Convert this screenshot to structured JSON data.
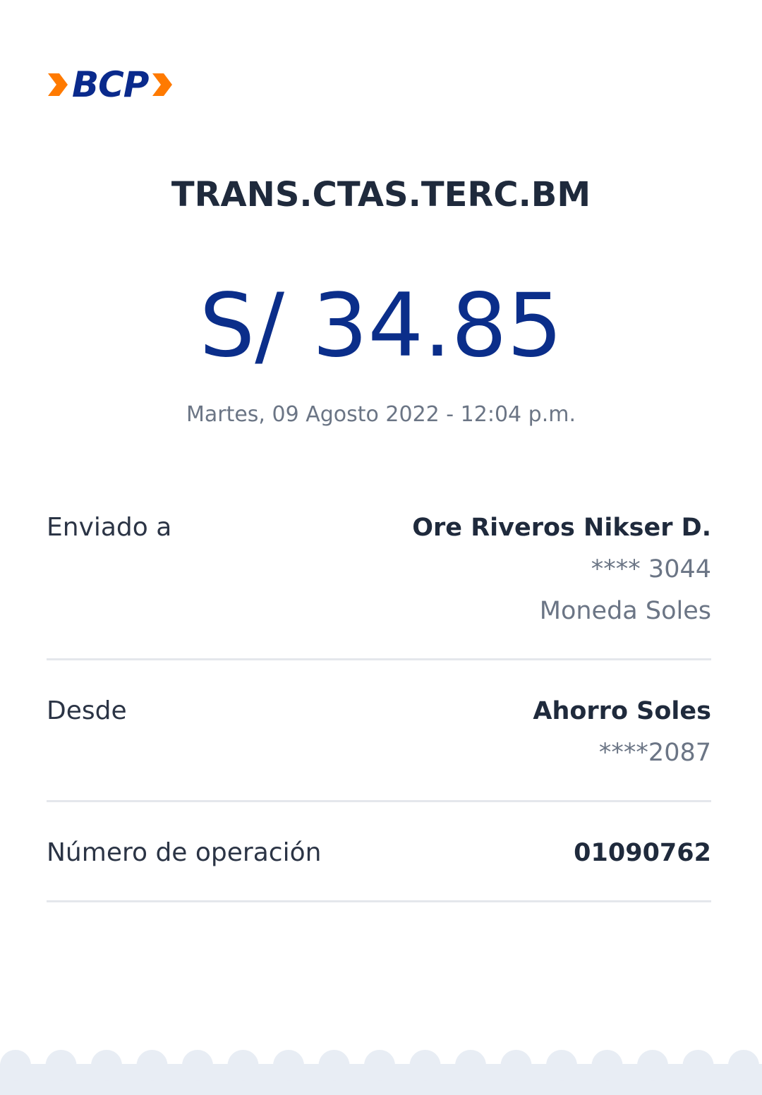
{
  "brand": {
    "name": "BCP",
    "primary_color": "#0a2a8c",
    "accent_color": "#ff7a00"
  },
  "receipt": {
    "title": "TRANS.CTAS.TERC.BM",
    "amount": "S/ 34.85",
    "datetime": "Martes, 09 Agosto 2022 - 12:04 p.m."
  },
  "details": {
    "sent_to": {
      "label": "Enviado a",
      "name": "Ore Riveros Nikser D.",
      "account": "**** 3044",
      "currency": "Moneda Soles"
    },
    "from": {
      "label": "Desde",
      "account_type": "Ahorro Soles",
      "account": "****2087"
    },
    "operation": {
      "label": "Número de operación",
      "number": "01090762"
    }
  },
  "icons": {
    "logo_left": "chevron-right-icon",
    "logo_right": "chevron-right-icon",
    "footer": "scalloped-edge"
  }
}
